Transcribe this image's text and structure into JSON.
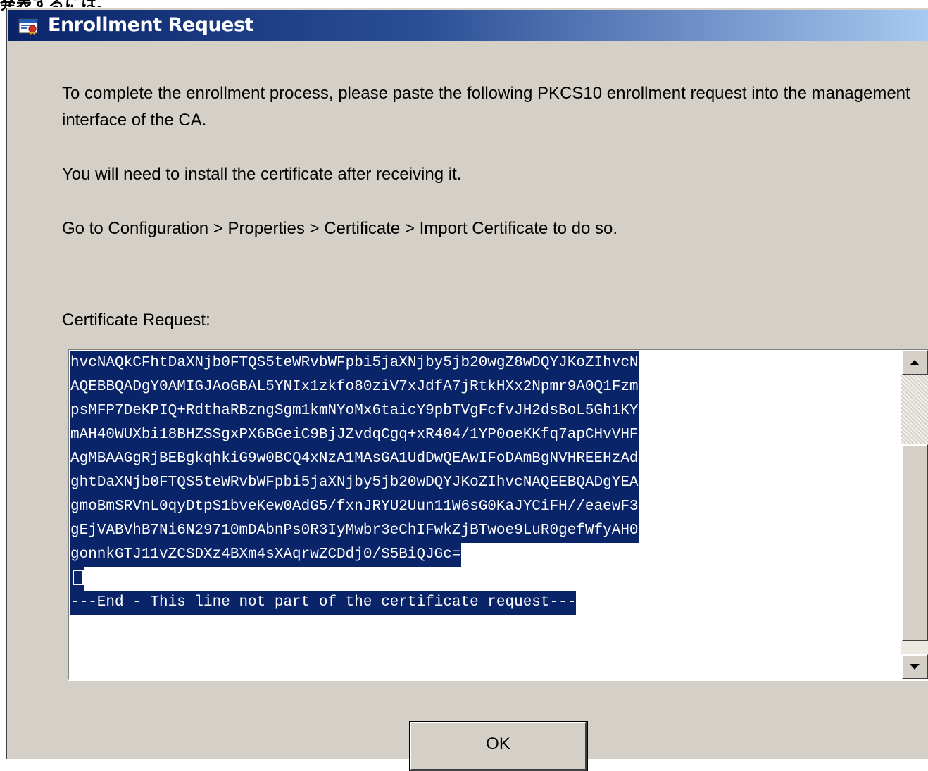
{
  "top_fragment": "発表するには、",
  "window": {
    "title": "Enrollment Request",
    "icon": "certificate-window-icon"
  },
  "messages": {
    "intro": "To complete the enrollment process, please paste the following PKCS10 enrollment request into the management interface of the CA.",
    "install_note": "You will need to install the certificate after receiving it.",
    "navigation": "Go to Configuration > Properties > Certificate > Import Certificate to do so."
  },
  "certificate": {
    "label": "Certificate Request:",
    "lines": [
      "hvcNAQkCFhtDaXNjb0FTQS5teWRvbWFpbi5jaXNjby5jb20wgZ8wDQYJKoZIhvcN",
      "AQEBBQADgY0AMIGJAoGBAL5YNIx1zkfo80ziV7xJdfA7jRtkHXx2Npmr9A0Q1Fzm",
      "psMFP7DeKPIQ+RdthaRBzngSgm1kmNYoMx6taicY9pbTVgFcfvJH2dsBoL5Gh1KY",
      "mAH40WUXbi18BHZSSgxPX6BGeiC9BjJZvdqCgq+xR404/1YP0oeKKfq7apCHvVHF",
      "AgMBAAGgRjBEBgkqhkiG9w0BCQ4xNzA1MAsGA1UdDwQEAwIFoDAmBgNVHREEHzAd",
      "ghtDaXNjb0FTQS5teWRvbWFpbi5jaXNjby5jb20wDQYJKoZIhvcNAQEEBQADgYEA",
      "gmoBmSRVnL0qyDtpS1bveKew0AdG5/fxnJRYU2Uun11W6sG0KaJYCiFH//eaewF3",
      "gEjVABVhB7Ni6N29710mDAbnPs0R3IyMwbr3eChIFwkZjBTwoe9LuR0gefWfyAH0",
      "gonnkGTJ11vZCSDXz4BXm4sXAqrwZCDdj0/S5BiQJGc=",
      "",
      "---End - This line not part of the certificate request---"
    ]
  },
  "buttons": {
    "ok": "OK"
  },
  "colors": {
    "dialog_bg": "#d4d0c8",
    "title_start": "#0a246a",
    "title_end": "#a6caf0",
    "selection": "#0a246a"
  }
}
